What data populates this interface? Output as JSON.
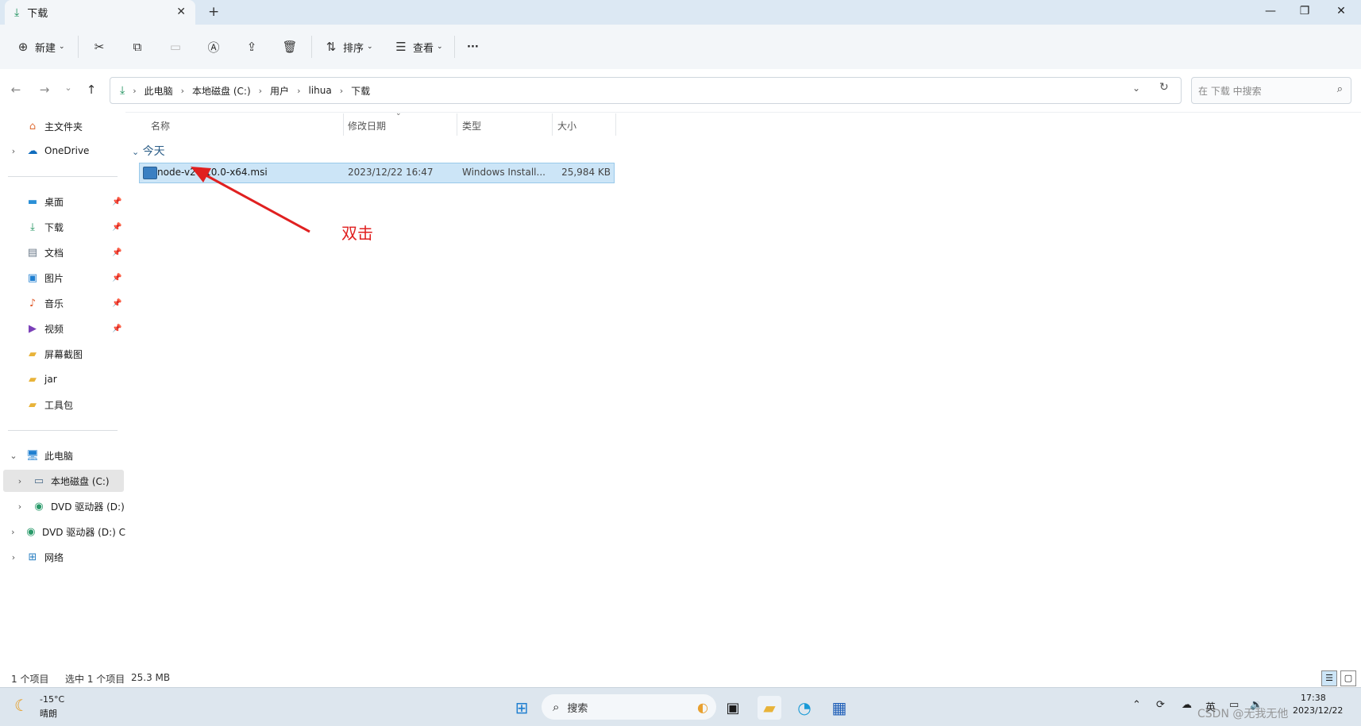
{
  "tab": {
    "title": "下载",
    "close": "✕",
    "new_tab": "+"
  },
  "window": {
    "minimize": "—",
    "maximize": "❐",
    "close": "✕"
  },
  "toolbar": {
    "new_label": "新建",
    "sort_label": "排序",
    "view_label": "查看",
    "more": "···"
  },
  "address": {
    "segments": [
      "此电脑",
      "本地磁盘 (C:)",
      "用户",
      "lihua",
      "下载"
    ],
    "search_placeholder": "在 下载 中搜索"
  },
  "sidebar": {
    "home": "主文件夹",
    "onedrive": "OneDrive",
    "quick": [
      "桌面",
      "下载",
      "文档",
      "图片",
      "音乐",
      "视频",
      "屏幕截图",
      "jar",
      "工具包"
    ],
    "this_pc": "此电脑",
    "drive_c": "本地磁盘 (C:)",
    "dvd1": "DVD 驱动器 (D:)",
    "dvd2": "DVD 驱动器 (D:) C",
    "network": "网络"
  },
  "columns": {
    "name": "名称",
    "date": "修改日期",
    "type": "类型",
    "size": "大小"
  },
  "group_label": "今天",
  "file": {
    "name": "node-v20.10.0-x64.msi",
    "date": "2023/12/22 16:47",
    "type": "Windows Install...",
    "size": "25,984 KB"
  },
  "annotation": "双击",
  "status": {
    "count": "1 个项目",
    "selected": "选中 1 个项目",
    "size": "25.3 MB"
  },
  "taskbar": {
    "temp": "-15°C",
    "weather": "晴朗",
    "search": "搜索",
    "lang": "英",
    "time": "17:38",
    "date": "2023/12/22",
    "watermark": "CSDN @无我无他"
  },
  "colors": {
    "accent": "#1a8f5a",
    "selection": "#cce5f7",
    "annotation": "#e02020"
  }
}
